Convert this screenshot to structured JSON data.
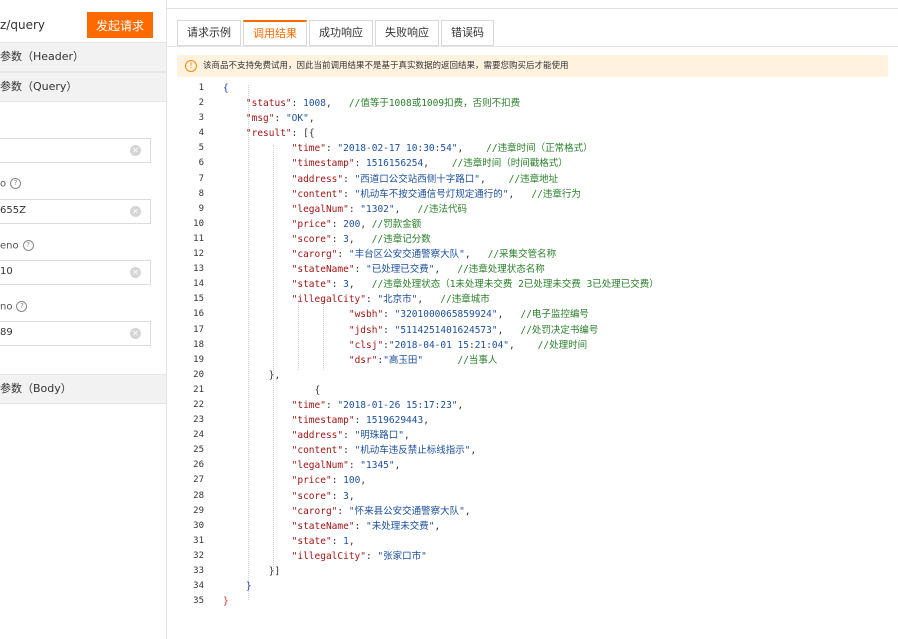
{
  "left": {
    "url_text": "z/query",
    "send_button": "发起请求",
    "header_section": "参数（Header）",
    "query_section": "参数（Query）",
    "body_section": "参数（Body）",
    "fields": [
      {
        "label": "",
        "value": ""
      },
      {
        "label": "o",
        "value": "655Z"
      },
      {
        "label": "eno",
        "value": "10"
      },
      {
        "label": "no",
        "value": "89"
      }
    ]
  },
  "tabs": [
    {
      "label": "请求示例",
      "active": false
    },
    {
      "label": "调用结果",
      "active": true
    },
    {
      "label": "成功响应",
      "active": false
    },
    {
      "label": "失败响应",
      "active": false
    },
    {
      "label": "错误码",
      "active": false
    }
  ],
  "notice": "该商品不支持免费试用，因此当前调用结果不是基于真实数据的返回结果，需要您购买后才能使用",
  "code_lines": [
    {
      "n": "1",
      "parts": [
        [
          "br",
          "{"
        ]
      ]
    },
    {
      "n": "2",
      "parts": [
        [
          "p",
          "    "
        ],
        [
          "k",
          "\"status\""
        ],
        [
          "p",
          ": "
        ],
        [
          "n",
          "1008"
        ],
        [
          "p",
          ",   "
        ],
        [
          "c",
          "//值等于1008或1009扣费，否则不扣费"
        ]
      ]
    },
    {
      "n": "3",
      "parts": [
        [
          "p",
          "    "
        ],
        [
          "k",
          "\"msg\""
        ],
        [
          "p",
          ": "
        ],
        [
          "s",
          "\"OK\""
        ],
        [
          "p",
          ","
        ]
      ]
    },
    {
      "n": "4",
      "parts": [
        [
          "p",
          "    "
        ],
        [
          "k",
          "\"result\""
        ],
        [
          "p",
          ": [{"
        ]
      ]
    },
    {
      "n": "5",
      "parts": [
        [
          "p",
          "            "
        ],
        [
          "k",
          "\"time\""
        ],
        [
          "p",
          ": "
        ],
        [
          "s",
          "\"2018-02-17 10:30:54\""
        ],
        [
          "p",
          ",    "
        ],
        [
          "c",
          "//违章时间（正常格式）"
        ]
      ]
    },
    {
      "n": "6",
      "parts": [
        [
          "p",
          "            "
        ],
        [
          "k",
          "\"timestamp\""
        ],
        [
          "p",
          ": "
        ],
        [
          "n",
          "1516156254"
        ],
        [
          "p",
          ",    "
        ],
        [
          "c",
          "//违章时间（时间戳格式）"
        ]
      ]
    },
    {
      "n": "7",
      "parts": [
        [
          "p",
          "            "
        ],
        [
          "k",
          "\"address\""
        ],
        [
          "p",
          ": "
        ],
        [
          "s",
          "\"西道口公交站西侧十字路口\""
        ],
        [
          "p",
          ",    "
        ],
        [
          "c",
          "//违章地址"
        ]
      ]
    },
    {
      "n": "8",
      "parts": [
        [
          "p",
          "            "
        ],
        [
          "k",
          "\"content\""
        ],
        [
          "p",
          ": "
        ],
        [
          "s",
          "\"机动车不按交通信号灯规定通行的\""
        ],
        [
          "p",
          ",   "
        ],
        [
          "c",
          "//违章行为"
        ]
      ]
    },
    {
      "n": "9",
      "parts": [
        [
          "p",
          "            "
        ],
        [
          "k",
          "\"legalNum\""
        ],
        [
          "p",
          ": "
        ],
        [
          "s",
          "\"1302\""
        ],
        [
          "p",
          ",   "
        ],
        [
          "c",
          "//违法代码"
        ]
      ]
    },
    {
      "n": "10",
      "parts": [
        [
          "p",
          "            "
        ],
        [
          "k",
          "\"price\""
        ],
        [
          "p",
          ": "
        ],
        [
          "n",
          "200"
        ],
        [
          "p",
          ", "
        ],
        [
          "c",
          "//罚款金额"
        ]
      ]
    },
    {
      "n": "11",
      "parts": [
        [
          "p",
          "            "
        ],
        [
          "k",
          "\"score\""
        ],
        [
          "p",
          ": "
        ],
        [
          "n",
          "3"
        ],
        [
          "p",
          ",   "
        ],
        [
          "c",
          "//违章记分数"
        ]
      ]
    },
    {
      "n": "12",
      "parts": [
        [
          "p",
          "            "
        ],
        [
          "k",
          "\"carorg\""
        ],
        [
          "p",
          ": "
        ],
        [
          "s",
          "\"丰台区公安交通警察大队\""
        ],
        [
          "p",
          ",   "
        ],
        [
          "c",
          "//采集交管名称"
        ]
      ]
    },
    {
      "n": "13",
      "parts": [
        [
          "p",
          "            "
        ],
        [
          "k",
          "\"stateName\""
        ],
        [
          "p",
          ": "
        ],
        [
          "s",
          "\"已处理已交费\""
        ],
        [
          "p",
          ",   "
        ],
        [
          "c",
          "//违章处理状态名称"
        ]
      ]
    },
    {
      "n": "14",
      "parts": [
        [
          "p",
          "            "
        ],
        [
          "k",
          "\"state\""
        ],
        [
          "p",
          ": "
        ],
        [
          "n",
          "3"
        ],
        [
          "p",
          ",   "
        ],
        [
          "c",
          "//违章处理状态（1未处理未交费 2已处理未交费 3已处理已交费）"
        ]
      ]
    },
    {
      "n": "15",
      "parts": [
        [
          "p",
          "            "
        ],
        [
          "k",
          "\"illegalCity\""
        ],
        [
          "p",
          ": "
        ],
        [
          "s",
          "\"北京市\""
        ],
        [
          "p",
          ",   "
        ],
        [
          "c",
          "//违章城市"
        ]
      ]
    },
    {
      "n": "16",
      "parts": [
        [
          "p",
          "                      "
        ],
        [
          "k",
          "\"wsbh\""
        ],
        [
          "p",
          ": "
        ],
        [
          "s",
          "\"3201000065859924\""
        ],
        [
          "p",
          ",   "
        ],
        [
          "c",
          "//电子监控编号"
        ]
      ]
    },
    {
      "n": "17",
      "parts": [
        [
          "p",
          "                      "
        ],
        [
          "k",
          "\"jdsh\""
        ],
        [
          "p",
          ": "
        ],
        [
          "s",
          "\"5114251401624573\""
        ],
        [
          "p",
          ",   "
        ],
        [
          "c",
          "//处罚决定书编号"
        ]
      ]
    },
    {
      "n": "18",
      "parts": [
        [
          "p",
          "                      "
        ],
        [
          "k",
          "\"clsj\""
        ],
        [
          "p",
          ":"
        ],
        [
          "s",
          "\"2018-04-01 15:21:04\""
        ],
        [
          "p",
          ",    "
        ],
        [
          "c",
          "//处理时间"
        ]
      ]
    },
    {
      "n": "19",
      "parts": [
        [
          "p",
          "                      "
        ],
        [
          "k",
          "\"dsr\""
        ],
        [
          "p",
          ":"
        ],
        [
          "s",
          "\"高玉田\""
        ],
        [
          "p",
          "      "
        ],
        [
          "c",
          "//当事人"
        ]
      ]
    },
    {
      "n": "20",
      "parts": [
        [
          "p",
          "        },"
        ]
      ]
    },
    {
      "n": "21",
      "parts": [
        [
          "p",
          "                {"
        ]
      ]
    },
    {
      "n": "22",
      "parts": [
        [
          "p",
          "            "
        ],
        [
          "k",
          "\"time\""
        ],
        [
          "p",
          ": "
        ],
        [
          "s",
          "\"2018-01-26 15:17:23\""
        ],
        [
          "p",
          ","
        ]
      ]
    },
    {
      "n": "23",
      "parts": [
        [
          "p",
          "            "
        ],
        [
          "k",
          "\"timestamp\""
        ],
        [
          "p",
          ": "
        ],
        [
          "n",
          "1519629443"
        ],
        [
          "p",
          ","
        ]
      ]
    },
    {
      "n": "24",
      "parts": [
        [
          "p",
          "            "
        ],
        [
          "k",
          "\"address\""
        ],
        [
          "p",
          ": "
        ],
        [
          "s",
          "\"明珠路口\""
        ],
        [
          "p",
          ","
        ]
      ]
    },
    {
      "n": "25",
      "parts": [
        [
          "p",
          "            "
        ],
        [
          "k",
          "\"content\""
        ],
        [
          "p",
          ": "
        ],
        [
          "s",
          "\"机动车违反禁止标线指示\""
        ],
        [
          "p",
          ","
        ]
      ]
    },
    {
      "n": "26",
      "parts": [
        [
          "p",
          "            "
        ],
        [
          "k",
          "\"legalNum\""
        ],
        [
          "p",
          ": "
        ],
        [
          "s",
          "\"1345\""
        ],
        [
          "p",
          ","
        ]
      ]
    },
    {
      "n": "27",
      "parts": [
        [
          "p",
          "            "
        ],
        [
          "k",
          "\"price\""
        ],
        [
          "p",
          ": "
        ],
        [
          "n",
          "100"
        ],
        [
          "p",
          ","
        ]
      ]
    },
    {
      "n": "28",
      "parts": [
        [
          "p",
          "            "
        ],
        [
          "k",
          "\"score\""
        ],
        [
          "p",
          ": "
        ],
        [
          "n",
          "3"
        ],
        [
          "p",
          ","
        ]
      ]
    },
    {
      "n": "29",
      "parts": [
        [
          "p",
          "            "
        ],
        [
          "k",
          "\"carorg\""
        ],
        [
          "p",
          ": "
        ],
        [
          "s",
          "\"怀来县公安交通警察大队\""
        ],
        [
          "p",
          ","
        ]
      ]
    },
    {
      "n": "30",
      "parts": [
        [
          "p",
          "            "
        ],
        [
          "k",
          "\"stateName\""
        ],
        [
          "p",
          ": "
        ],
        [
          "s",
          "\"未处理未交费\""
        ],
        [
          "p",
          ","
        ]
      ]
    },
    {
      "n": "31",
      "parts": [
        [
          "p",
          "            "
        ],
        [
          "k",
          "\"state\""
        ],
        [
          "p",
          ": "
        ],
        [
          "n",
          "1"
        ],
        [
          "p",
          ","
        ]
      ]
    },
    {
      "n": "32",
      "parts": [
        [
          "p",
          "            "
        ],
        [
          "k",
          "\"illegalCity\""
        ],
        [
          "p",
          ": "
        ],
        [
          "s",
          "\"张家口市\""
        ]
      ]
    },
    {
      "n": "33",
      "parts": [
        [
          "p",
          "        }]"
        ]
      ]
    },
    {
      "n": "34",
      "parts": [
        [
          "p",
          "    "
        ],
        [
          "br",
          "}"
        ]
      ]
    },
    {
      "n": "35",
      "parts": [
        [
          "brr",
          "}"
        ]
      ]
    }
  ],
  "colors": {
    "accent": "#ff6a00",
    "notice_bg": "#fff3e0",
    "comment": "#2a7f2a",
    "string": "#1c4f9c",
    "key": "#a31515"
  }
}
